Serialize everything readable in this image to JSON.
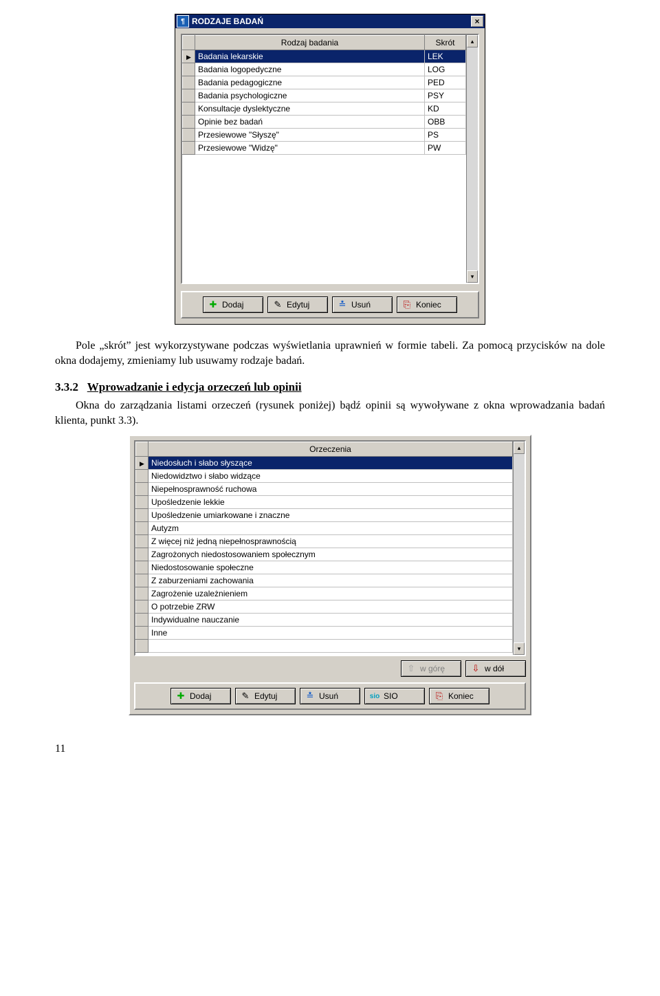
{
  "win1": {
    "title": "RODZAJE BADAŃ",
    "columns": {
      "col1": "Rodzaj badania",
      "col2": "Skrót"
    },
    "rows": [
      {
        "name": "Badania lekarskie",
        "abbr": "LEK",
        "selected": true
      },
      {
        "name": "Badania logopedyczne",
        "abbr": "LOG"
      },
      {
        "name": "Badania pedagogiczne",
        "abbr": "PED"
      },
      {
        "name": "Badania psychologiczne",
        "abbr": "PSY"
      },
      {
        "name": "Konsultacje dyslektyczne",
        "abbr": "KD"
      },
      {
        "name": "Opinie bez badań",
        "abbr": "OBB"
      },
      {
        "name": "Przesiewowe \"Słyszę\"",
        "abbr": "PS"
      },
      {
        "name": "Przesiewowe \"Widzę\"",
        "abbr": "PW"
      }
    ],
    "buttons": {
      "add": "Dodaj",
      "edit": "Edytuj",
      "del": "Usuń",
      "close": "Koniec"
    }
  },
  "para1": "Pole „skrót” jest wykorzystywane podczas wyświetlania uprawnień w formie tabeli. Za pomocą przycisków na dole okna dodajemy, zmieniamy lub usuwamy rodzaje badań.",
  "heading": {
    "num": "3.3.2",
    "text": "Wprowadzanie i edycja orzeczeń lub opinii"
  },
  "para2": "Okna do zarządzania listami orzeczeń (rysunek poniżej) bądź opinii są wywoływane z okna wprowadzania badań klienta,  punkt 3.3).",
  "win2": {
    "column": "Orzeczenia",
    "rows": [
      {
        "name": "Niedosłuch i słabo słyszące",
        "selected": true
      },
      {
        "name": "Niedowidztwo i słabo widzące"
      },
      {
        "name": "Niepełnosprawność ruchowa"
      },
      {
        "name": "Upośledzenie lekkie"
      },
      {
        "name": "Upośledzenie umiarkowane i znaczne"
      },
      {
        "name": "Autyzm"
      },
      {
        "name": "Z więcej niż jedną niepełnosprawnością"
      },
      {
        "name": "Zagrożonych niedostosowaniem społecznym"
      },
      {
        "name": "Niedostosowanie społeczne"
      },
      {
        "name": "Z zaburzeniami zachowania"
      },
      {
        "name": "Zagrożenie uzależnieniem"
      },
      {
        "name": "O potrzebie ZRW"
      },
      {
        "name": "Indywidualne nauczanie"
      },
      {
        "name": "Inne"
      }
    ],
    "buttons": {
      "up": "w górę",
      "down": "w dół",
      "add": "Dodaj",
      "edit": "Edytuj",
      "del": "Usuń",
      "sio": "SIO",
      "close": "Koniec"
    }
  },
  "pagenum": "11"
}
